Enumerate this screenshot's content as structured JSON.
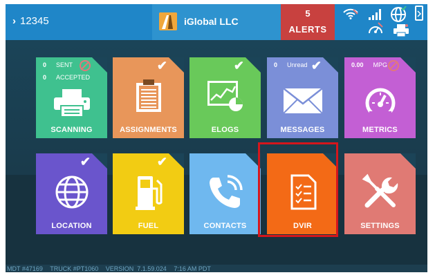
{
  "header": {
    "driver_id": "12345",
    "company_name": "iGlobal LLC",
    "alerts_count": "5",
    "alerts_label": "ALERTS"
  },
  "tiles": [
    {
      "label": "SCANNING",
      "color": "#3fc18f",
      "badge": "disabled",
      "stats": [
        {
          "value": "0",
          "label": "SENT"
        },
        {
          "value": "0",
          "label": "ACCEPTED"
        }
      ],
      "icon": "printer-icon"
    },
    {
      "label": "ASSIGNMENTS",
      "color": "#e8965a",
      "badge": "check",
      "icon": "clipboard-icon"
    },
    {
      "label": "ELOGS",
      "color": "#69c95a",
      "badge": "check",
      "icon": "elogs-chart-icon"
    },
    {
      "label": "MESSAGES",
      "color": "#7b8fd8",
      "badge": "check",
      "stats": [
        {
          "value": "0",
          "label": "Unread"
        }
      ],
      "icon": "envelope-icon"
    },
    {
      "label": "METRICS",
      "color": "#c35fd4",
      "badge": "disabled",
      "stats": [
        {
          "value": "0.00",
          "label": "MPG"
        }
      ],
      "icon": "gauge-icon"
    },
    {
      "label": "LOCATION",
      "color": "#6a55cc",
      "badge": "check",
      "icon": "globe-icon"
    },
    {
      "label": "FUEL",
      "color": "#f2cc13",
      "badge": "check",
      "icon": "fuel-pump-icon"
    },
    {
      "label": "CONTACTS",
      "color": "#6fb8ef",
      "badge": "none",
      "icon": "phone-icon"
    },
    {
      "label": "DVIR",
      "color": "#f36a16",
      "badge": "none",
      "icon": "checklist-icon"
    },
    {
      "label": "SETTINGS",
      "color": "#e07a74",
      "badge": "none",
      "icon": "tools-icon"
    }
  ],
  "footer": {
    "mdt": "MDT #47169",
    "truck": "TRUCK #PT1060",
    "version": "VERSION  7.1.59.024",
    "time": "7:16 AM PDT"
  },
  "colors": {
    "header_bg": "#1f86c8",
    "alerts_bg": "#c8413f",
    "screen_bg": "#1d3e4f",
    "highlight": "#d5161c"
  }
}
